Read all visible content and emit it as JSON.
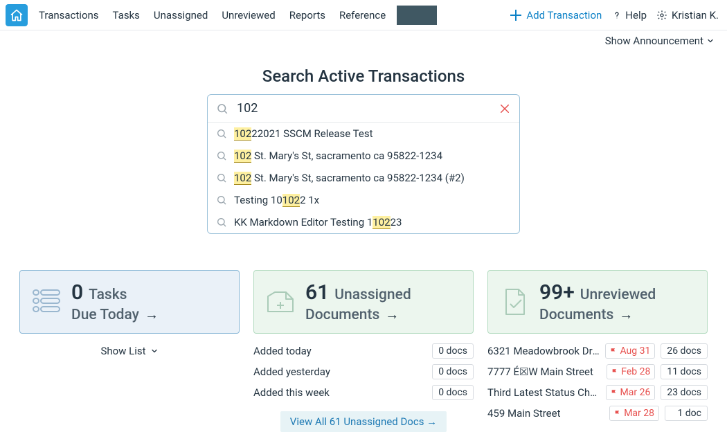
{
  "nav": {
    "items": [
      "Transactions",
      "Tasks",
      "Unassigned",
      "Unreviewed",
      "Reports",
      "Reference"
    ],
    "add_label": "Add Transaction",
    "help_label": "Help",
    "user_label": "Kristian K."
  },
  "announcement": {
    "label": "Show Announcement"
  },
  "search": {
    "title": "Search Active Transactions",
    "value": "102",
    "suggestions": [
      {
        "pre": "",
        "match": "102",
        "post": "22021 SSCM Release Test"
      },
      {
        "pre": "",
        "match": "102",
        "post": " St. Mary's St, sacramento ca 95822-1234"
      },
      {
        "pre": "",
        "match": "102",
        "post": " St. Mary's St, sacramento ca 95822-1234 (#2)"
      },
      {
        "pre": "Testing 10",
        "match": "102",
        "post": "2 1x"
      },
      {
        "pre": "KK Markdown Editor Testing 1",
        "match": "102",
        "post": "23"
      }
    ]
  },
  "tiles": {
    "tasks": {
      "number": "0",
      "label1": "Tasks",
      "label2": "Due Today",
      "arrow": "→",
      "show_list": "Show List"
    },
    "unassigned": {
      "number": "61",
      "label1": "Unassigned",
      "label2": "Documents",
      "arrow": "→",
      "rows": [
        {
          "label": "Added today",
          "count": "0 docs"
        },
        {
          "label": "Added yesterday",
          "count": "0 docs"
        },
        {
          "label": "Added this week",
          "count": "0 docs"
        }
      ],
      "view_all": "View All 61 Unassigned Docs →"
    },
    "unreviewed": {
      "number": "99+",
      "label1": "Unreviewed",
      "label2": "Documents",
      "arrow": "→",
      "rows": [
        {
          "label": "6321 Meadowbrook Driv…",
          "date": "Aug 31",
          "count": "26 docs"
        },
        {
          "label": "7777 É☒W Main Street",
          "date": "Feb 28",
          "count": "11 docs"
        },
        {
          "label": "Third Latest Status Cha…",
          "date": "Mar 26",
          "count": "23 docs"
        },
        {
          "label": "459 Main Street",
          "date": "Mar 28",
          "count": "1 doc"
        }
      ]
    }
  }
}
